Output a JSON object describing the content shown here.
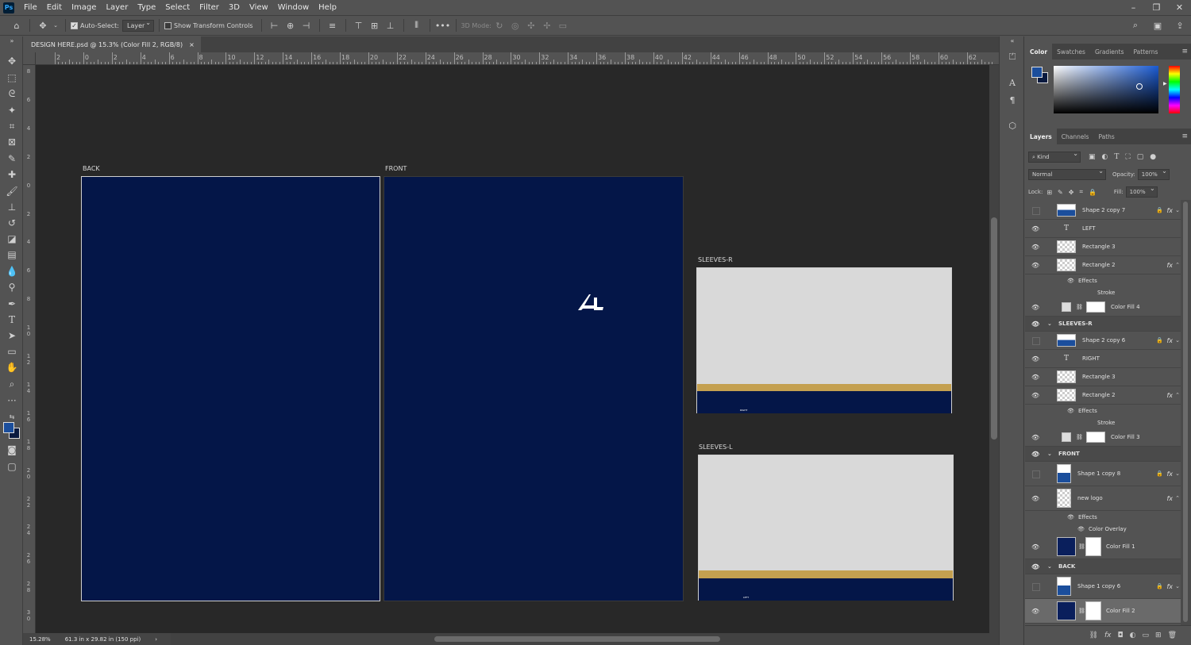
{
  "app_icon": "Ps",
  "menu": [
    "File",
    "Edit",
    "Image",
    "Layer",
    "Type",
    "Select",
    "Filter",
    "3D",
    "View",
    "Window",
    "Help"
  ],
  "window_controls": [
    "–",
    "❐",
    "✕"
  ],
  "options_bar": {
    "auto_select_label": "Auto-Select:",
    "auto_select_checked": true,
    "auto_select_target": "Layer",
    "show_transform_label": "Show Transform Controls",
    "show_transform_checked": false,
    "mode_3d_label": "3D Mode:"
  },
  "doc_tab": {
    "title": "DESIGN HERE.psd @ 15.3% (Color Fill 2, RGB/8)",
    "close": "×"
  },
  "ruler_h": [
    "2",
    "0",
    "2",
    "4",
    "6",
    "8",
    "10",
    "12",
    "14",
    "16",
    "18",
    "20",
    "22",
    "24",
    "26",
    "28",
    "30",
    "32",
    "34",
    "36",
    "38",
    "40",
    "42",
    "44",
    "46",
    "48",
    "50",
    "52",
    "54",
    "56",
    "58",
    "60",
    "62"
  ],
  "ruler_v": [
    "8",
    "6",
    "4",
    "2",
    "0",
    "2",
    "4",
    "6",
    "8",
    "10",
    "12",
    "14",
    "16",
    "18",
    "20",
    "22",
    "24",
    "26",
    "28",
    "30"
  ],
  "canvas": {
    "back_label": "BACK",
    "front_label": "FRONT",
    "sleeves_r_label": "SLEEVES-R",
    "sleeves_l_label": "SLEEVES-L",
    "sleeve_r_text": "RIGHT",
    "sleeve_l_text": "LEFT",
    "navy_color": "#041648",
    "gold_color": "#c4a050",
    "sleeve_color": "#d9d9d9"
  },
  "status": {
    "zoom": "15.28%",
    "doc_size": "61.3 in x 29.82 in (150 ppi)",
    "arrow": "›"
  },
  "color_panel": {
    "tabs": [
      "Color",
      "Swatches",
      "Gradients",
      "Patterns"
    ],
    "active": "Color",
    "foreground": "#1b4e9c",
    "background": "#0a1a3f"
  },
  "layers_panel": {
    "tabs": [
      "Layers",
      "Channels",
      "Paths"
    ],
    "active": "Layers",
    "kind": "Kind",
    "blend_mode": "Normal",
    "opacity_label": "Opacity:",
    "opacity": "100%",
    "lock_label": "Lock:",
    "fill_label": "Fill:",
    "fill": "100%",
    "rows": [
      {
        "name": "Shape 2 copy 7",
        "visible": false,
        "thumb": "mixed",
        "lock": true,
        "fx": true
      },
      {
        "name": "LEFT",
        "visible": true,
        "thumb": "type"
      },
      {
        "name": "Rectangle 3",
        "visible": true,
        "thumb": "checker"
      },
      {
        "name": "Rectangle 2",
        "visible": true,
        "thumb": "checker",
        "fx": true
      },
      {
        "name": "Effects",
        "sub": true
      },
      {
        "name": "Stroke",
        "sub2": true
      },
      {
        "name": "Color Fill 4",
        "visible": true,
        "thumb": "white"
      },
      {
        "name": "SLEEVES-R",
        "group": true
      },
      {
        "name": "Shape 2 copy 6",
        "visible": false,
        "thumb": "mixed",
        "lock": true,
        "fx": true
      },
      {
        "name": "RIGHT",
        "visible": true,
        "thumb": "type"
      },
      {
        "name": "Rectangle 3",
        "visible": true,
        "thumb": "checker"
      },
      {
        "name": "Rectangle 2",
        "visible": true,
        "thumb": "checker",
        "fx": true
      },
      {
        "name": "Effects",
        "sub": true
      },
      {
        "name": "Stroke",
        "sub2": true
      },
      {
        "name": "Color Fill 3",
        "visible": true,
        "thumb": "white"
      },
      {
        "name": "FRONT",
        "group": true
      },
      {
        "name": "Shape 1 copy 8",
        "visible": false,
        "thumb": "mixed",
        "lock": true,
        "fx": true
      },
      {
        "name": "new logo",
        "visible": true,
        "thumb": "checker",
        "fx": true
      },
      {
        "name": "Effects",
        "sub": true
      },
      {
        "name": "Color Overlay",
        "sub2": true
      },
      {
        "name": "Color Fill 1",
        "visible": true,
        "thumb": "navy"
      },
      {
        "name": "BACK",
        "group": true
      },
      {
        "name": "Shape 1 copy 6",
        "visible": false,
        "thumb": "mixed",
        "lock": true,
        "fx": true
      },
      {
        "name": "Color Fill 2",
        "visible": true,
        "thumb": "navy",
        "selected": true
      }
    ]
  }
}
